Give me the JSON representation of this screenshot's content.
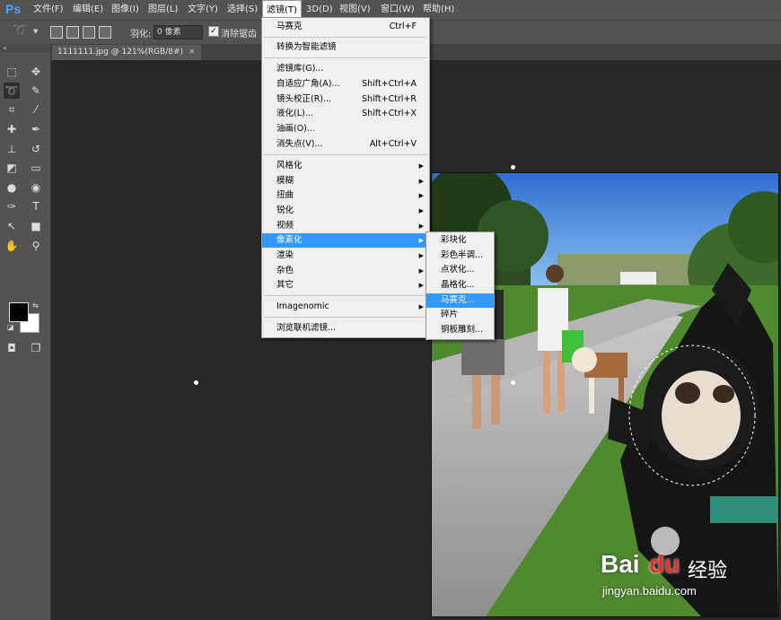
{
  "app": {
    "logo": "Ps"
  },
  "menubar": [
    {
      "label": "文件(F)"
    },
    {
      "label": "编辑(E)"
    },
    {
      "label": "图像(I)"
    },
    {
      "label": "图层(L)"
    },
    {
      "label": "文字(Y)"
    },
    {
      "label": "选择(S)"
    },
    {
      "label": "滤镜(T)"
    },
    {
      "label": "3D(D)"
    },
    {
      "label": "视图(V)"
    },
    {
      "label": "窗口(W)"
    },
    {
      "label": "帮助(H)"
    }
  ],
  "options": {
    "feather_label": "羽化:",
    "feather_value": "0 像素",
    "antialias_label": "消除锯齿"
  },
  "document_tab": {
    "title": "1111111.jpg @ 121%(RGB/8#)",
    "close": "×"
  },
  "toolbar_header": "«",
  "filter_menu": [
    {
      "label": "马赛克",
      "shortcut": "Ctrl+F"
    },
    {
      "label": "转换为智能滤镜"
    },
    {
      "label": "滤镜库(G)..."
    },
    {
      "label": "自适应广角(A)...",
      "shortcut": "Shift+Ctrl+A"
    },
    {
      "label": "镜头校正(R)...",
      "shortcut": "Shift+Ctrl+R"
    },
    {
      "label": "液化(L)...",
      "shortcut": "Shift+Ctrl+X"
    },
    {
      "label": "油画(O)..."
    },
    {
      "label": "消失点(V)...",
      "shortcut": "Alt+Ctrl+V"
    },
    {
      "label": "风格化"
    },
    {
      "label": "模糊"
    },
    {
      "label": "扭曲"
    },
    {
      "label": "锐化"
    },
    {
      "label": "视频"
    },
    {
      "label": "像素化"
    },
    {
      "label": "渲染"
    },
    {
      "label": "杂色"
    },
    {
      "label": "其它"
    },
    {
      "label": "Imagenomic"
    },
    {
      "label": "浏览联机滤镜..."
    }
  ],
  "submenu_arrow": "▶",
  "pixelate_submenu": [
    {
      "label": "彩块化"
    },
    {
      "label": "彩色半调..."
    },
    {
      "label": "点状化..."
    },
    {
      "label": "晶格化..."
    },
    {
      "label": "马赛克..."
    },
    {
      "label": "碎片"
    },
    {
      "label": "铜板雕刻..."
    }
  ],
  "watermark": {
    "brand": "Bai",
    "brand_suffix": "du",
    "brand_cn": "经验",
    "url": "jingyan.baidu.com"
  },
  "colors": {
    "highlight": "#3399ff",
    "menubar": "#535353",
    "canvas": "#282828"
  }
}
